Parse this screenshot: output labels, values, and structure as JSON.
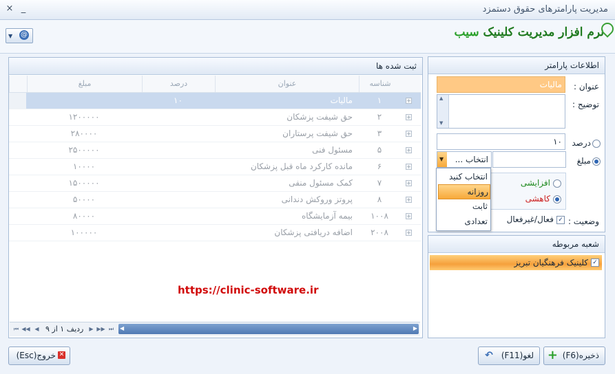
{
  "window": {
    "title": "مدیریت پارامترهای حقوق دستمزد",
    "close_label": "×",
    "pin_label": "_"
  },
  "brand": {
    "logo_text_main": "نرم افزار مدیریت کلینیک",
    "logo_text_accent": "سیب"
  },
  "grid": {
    "title": "ثبت شده ها",
    "columns": [
      "شناسه",
      "عنوان",
      "درصد",
      "مبلغ"
    ],
    "rows": [
      {
        "id": "۱",
        "title": "مالیات",
        "percent": "۱۰",
        "amount": "",
        "selected": true
      },
      {
        "id": "۲",
        "title": "حق شیفت پزشکان",
        "percent": "",
        "amount": "۱۲۰۰۰۰۰"
      },
      {
        "id": "۳",
        "title": "حق شیفت پرستاران",
        "percent": "",
        "amount": "۲۸۰۰۰۰"
      },
      {
        "id": "۵",
        "title": "مسئول فنی",
        "percent": "",
        "amount": "۲۵۰۰۰۰۰"
      },
      {
        "id": "۶",
        "title": "مانده کارکرد ماه قبل پزشکان",
        "percent": "",
        "amount": "۱۰۰۰۰"
      },
      {
        "id": "۷",
        "title": "کمک مسئول منفی",
        "percent": "",
        "amount": "۱۵۰۰۰۰۰"
      },
      {
        "id": "۸",
        "title": "پروتز وروکش دندانی",
        "percent": "",
        "amount": "۵۰۰۰۰"
      },
      {
        "id": "۱۰۰۸",
        "title": "بیمه آزمایشگاه",
        "percent": "",
        "amount": "۸۰۰۰۰"
      },
      {
        "id": "۲۰۰۸",
        "title": "اضافه دریافتی پزشکان",
        "percent": "",
        "amount": "۱۰۰۰۰۰"
      }
    ],
    "nav_label": "ردیف ۱ از ۹"
  },
  "params": {
    "header": "اطلاعات پارامتر",
    "title_label": "عنوان :",
    "title_value": "مالیات",
    "desc_label": "توضیح :",
    "percent_label": "درصد",
    "percent_value": "۱۰",
    "amount_label": "مبلغ",
    "select_value": "انتخاب ...",
    "increase_label": "افزایشی",
    "decrease_label": "کاهشی",
    "status_label": "وضعیت :",
    "active_label": "فعال/غیرفعال",
    "dropdown_options": [
      "انتخاب کنید",
      "روزانه",
      "ثابت",
      "تعدادی"
    ],
    "dropdown_highlighted": 1
  },
  "branch": {
    "header": "شعبه مربوطه",
    "item": "کلینیک فرهنگیان تبریز"
  },
  "watermark_url": "https://clinic-software.ir",
  "buttons": {
    "save": "ذخیره(F6)",
    "cancel": "لغو(F11)",
    "exit": "خروج(Esc)"
  },
  "colors": {
    "accent_blue": "#4f79b3",
    "highlight_orange": "#f7a93a",
    "save_green": "#2aa02a",
    "exit_red": "#d9302a",
    "url_red": "#d10a0a",
    "title_field_bg": "#ffc985"
  }
}
